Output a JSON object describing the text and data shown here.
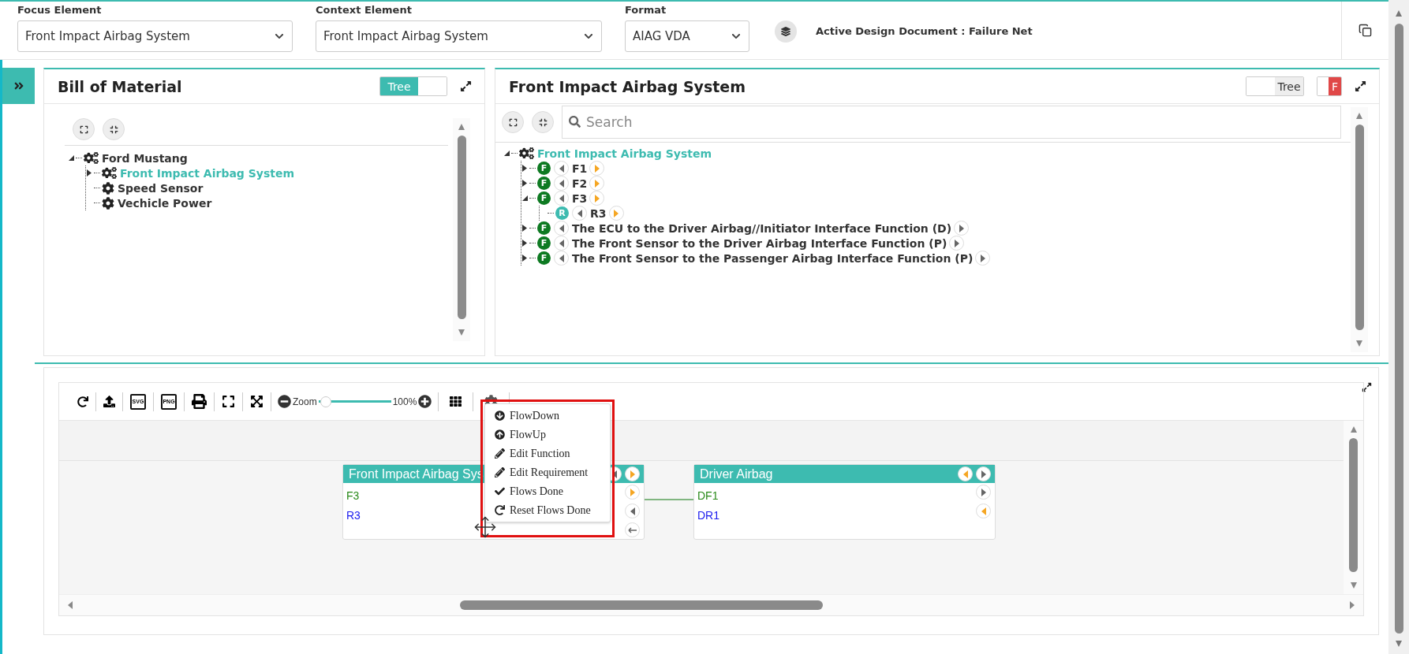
{
  "top_bar": {
    "selects": [
      {
        "label": "Focus Element",
        "value": "Front Impact Airbag System"
      },
      {
        "label": "Context Element",
        "value": "Front Impact Airbag System"
      },
      {
        "label": "Format",
        "value": "AIAG VDA"
      }
    ],
    "active_document": "Active Design Document : Failure Net"
  },
  "bom_panel": {
    "title": "Bill of Material",
    "view_toggle": {
      "label": "Tree",
      "on": true
    },
    "tree": [
      {
        "label": "Ford Mustang",
        "kind": "assembly",
        "selected": false,
        "expanded": true,
        "children": [
          {
            "label": "Front Impact Airbag System",
            "kind": "assembly",
            "selected": true,
            "expanded": false
          },
          {
            "label": "Speed Sensor",
            "kind": "part",
            "selected": false
          },
          {
            "label": "Vechicle Power",
            "kind": "part",
            "selected": false
          }
        ]
      }
    ]
  },
  "function_panel": {
    "title": "Front Impact Airbag System",
    "view_toggle": {
      "label": "Tree",
      "on": false
    },
    "filter_toggle": {
      "label": "F",
      "on": true
    },
    "search": {
      "placeholder": "Search"
    },
    "tree": [
      {
        "label": "Front Impact Airbag System",
        "kind": "assembly",
        "selected": true,
        "expanded": true,
        "children": [
          {
            "badge": "F",
            "label": "F1",
            "kind": "function",
            "selected": false,
            "expanded": false,
            "color": "#f5a623"
          },
          {
            "badge": "F",
            "label": "F2",
            "kind": "function",
            "selected": false,
            "expanded": false,
            "color": "#f5a623"
          },
          {
            "badge": "F",
            "label": "F3",
            "kind": "function",
            "selected": false,
            "expanded": true,
            "color": "#f5a623",
            "children": [
              {
                "badge": "R",
                "label": "R3",
                "kind": "requirement",
                "selected": false,
                "color": "#f5a623"
              }
            ]
          },
          {
            "badge": "F",
            "label": "The ECU to the Driver Airbag//Initiator Interface Function (D)",
            "kind": "function",
            "selected": false,
            "expanded": false,
            "color": "#666666"
          },
          {
            "badge": "F",
            "label": "The Front Sensor to the Driver Airbag Interface Function (P)",
            "kind": "function",
            "selected": false,
            "expanded": false,
            "color": "#666666"
          },
          {
            "badge": "F",
            "label": "The Front Sensor to the Passenger Airbag Interface Function (P)",
            "kind": "function",
            "selected": false,
            "expanded": false,
            "color": "#666666"
          }
        ]
      }
    ]
  },
  "diagram": {
    "toolbar": [
      {
        "kind": "refresh"
      },
      {
        "kind": "upload"
      },
      {
        "kind": "file",
        "label": "SVG"
      },
      {
        "kind": "file",
        "label": "PNG"
      },
      {
        "kind": "print"
      },
      {
        "kind": "fullscreen"
      },
      {
        "kind": "fit"
      }
    ],
    "zoom": {
      "label": "Zoom",
      "level": 0.1,
      "reading": "100%"
    },
    "tools": [
      {
        "kind": "grid"
      },
      {
        "kind": "settings"
      }
    ],
    "nodes": [
      {
        "title": "Front Impact Airbag Sys",
        "rows": [
          {
            "label": "F3",
            "kind": "function"
          },
          {
            "label": "R3",
            "kind": "requirement"
          }
        ],
        "header_ports": [
          {
            "kind": "left",
            "color": "#666666"
          },
          {
            "kind": "right",
            "color": "#f5a623"
          }
        ],
        "side_ports": [
          {
            "kind": "right",
            "color": "#f5a623"
          },
          {
            "kind": "left",
            "color": "#666666"
          },
          {
            "kind": "back",
            "color": "#666666"
          }
        ]
      },
      {
        "title": "Driver Airbag",
        "rows": [
          {
            "label": "DF1",
            "kind": "function"
          },
          {
            "label": "DR1",
            "kind": "requirement"
          }
        ],
        "header_ports": [
          {
            "kind": "left",
            "color": "#f5a623"
          },
          {
            "kind": "right",
            "color": "#666666"
          }
        ],
        "side_ports": [
          {
            "kind": "right",
            "color": "#666666"
          },
          {
            "kind": "left",
            "color": "#f5a623"
          }
        ]
      }
    ],
    "context_menu": [
      {
        "label": "FlowDown",
        "kind": "down"
      },
      {
        "label": "FlowUp",
        "kind": "up"
      },
      {
        "label": "Edit Function",
        "kind": "edit"
      },
      {
        "label": "Edit Requirement",
        "kind": "edit"
      },
      {
        "label": "Flows Done",
        "kind": "check"
      },
      {
        "label": "Reset Flows Done",
        "kind": "reset"
      }
    ]
  }
}
